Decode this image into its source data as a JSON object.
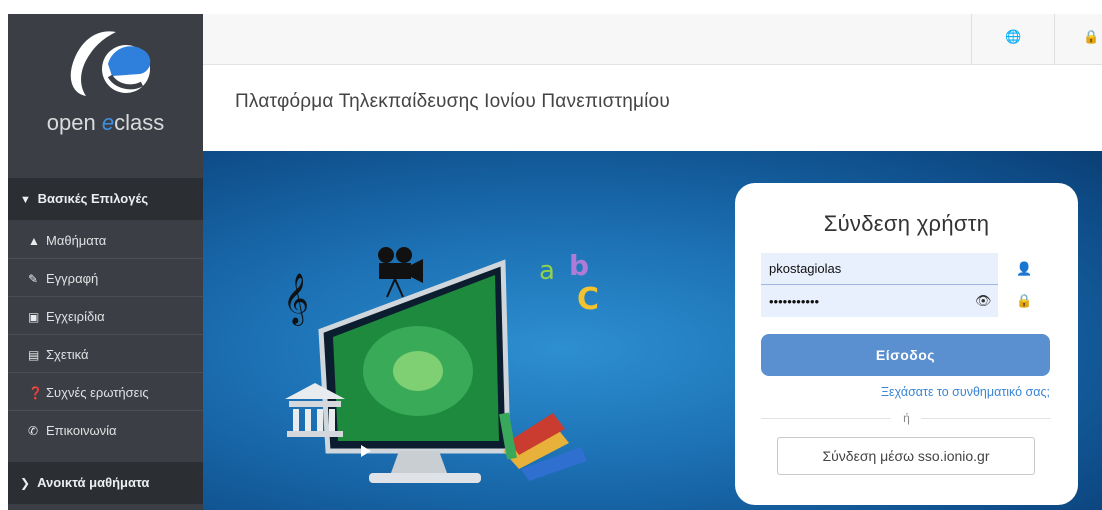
{
  "brand": {
    "logo_pre": "open ",
    "logo_e": "e",
    "logo_post": "class"
  },
  "sidebar": {
    "section_main": "Βασικές Επιλογές",
    "section_main_chevron": "down",
    "items": [
      {
        "label": "Μαθήματα",
        "icon": "graduation-cap-icon"
      },
      {
        "label": "Εγγραφή",
        "icon": "edit-icon"
      },
      {
        "label": "Εγχειρίδια",
        "icon": "manual-icon"
      },
      {
        "label": "Σχετικά",
        "icon": "credit-card-icon"
      },
      {
        "label": "Συχνές ερωτήσεις",
        "icon": "question-icon"
      },
      {
        "label": "Επικοινωνία",
        "icon": "phone-icon"
      }
    ],
    "section_open": "Ανοικτά μαθήματα",
    "section_open_chevron": "right"
  },
  "topbar": {
    "icons": [
      "globe-icon",
      "lock-icon"
    ]
  },
  "page": {
    "title": "Πλατφόρμα Τηλεκπαίδευσης Ιονίου Πανεπιστημίου"
  },
  "login": {
    "title": "Σύνδεση χρήστη",
    "username_value": "pkostagiolas",
    "password_value": "•••••••••••",
    "submit_label": "Είσοδος",
    "forgot_label": "Ξεχάσατε το συνθηματικό σας;",
    "or_label": "ή",
    "sso_label": "Σύνδεση μέσω sso.ionio.gr"
  },
  "colors": {
    "accent": "#5a8fd0",
    "sidebar": "#3b3f45",
    "hero": "#1c71b4"
  }
}
